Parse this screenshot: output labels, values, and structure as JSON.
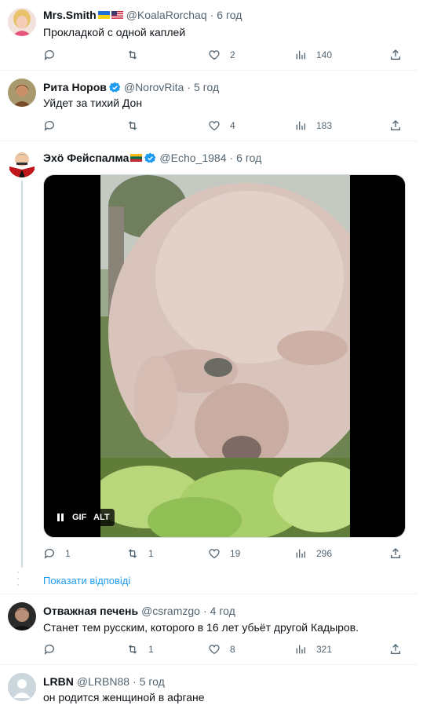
{
  "tweets": [
    {
      "name": "Mrs.Smith",
      "handle": "@KoalaRorchaq",
      "time": "6 год",
      "text": "Прокладкой с одной каплей",
      "replies": "",
      "retweets": "",
      "likes": "2",
      "views": "140"
    },
    {
      "name": "Рита Норов",
      "handle": "@NorovRita",
      "time": "5 год",
      "text": "Уйдет за тихий Дон",
      "replies": "",
      "retweets": "",
      "likes": "4",
      "views": "183"
    },
    {
      "name": "Эхӧ Фейспалма",
      "handle": "@Echo_1984",
      "time": "6 год",
      "text": "",
      "replies": "1",
      "retweets": "1",
      "likes": "19",
      "views": "296"
    },
    {
      "name": "Отважная печень",
      "handle": "@csramzgo",
      "time": "4 год",
      "text": "Станет тем русским, которого в 16 лет убьёт другой Кадыров.",
      "replies": "",
      "retweets": "1",
      "likes": "8",
      "views": "321"
    },
    {
      "name": "LRBN",
      "handle": "@LRBN88",
      "time": "5 год",
      "text": "он родится женщиной в афгане"
    }
  ],
  "media": {
    "gif_label": "GIF",
    "alt_label": "ALT",
    "pause_icon": "pause-icon"
  },
  "show_replies": "Показати відповіді",
  "dot": "·",
  "colors": {
    "accent": "#1d9bf0",
    "secondary_text": "#536471",
    "border": "#eff3f4"
  }
}
